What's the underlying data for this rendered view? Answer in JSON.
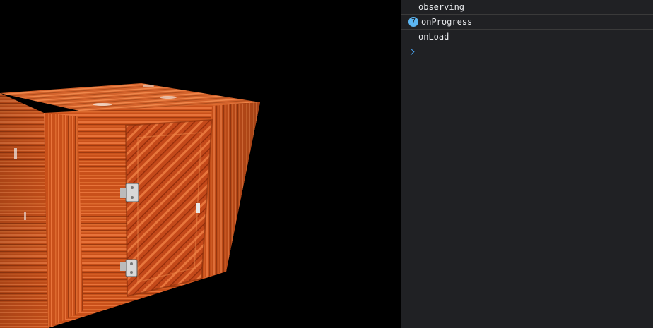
{
  "viewport": {
    "scene": "wooden crate rendered in 3D",
    "background_color": "#000000",
    "wood_color": "#d45a1c"
  },
  "console": {
    "messages": [
      {
        "text": "observing",
        "repeat": null
      },
      {
        "text": "onProgress",
        "repeat": "7"
      },
      {
        "text": "onLoad",
        "repeat": null
      }
    ],
    "prompt_icon": "chevron-right-icon",
    "badge_color": "#5cb6f2"
  }
}
